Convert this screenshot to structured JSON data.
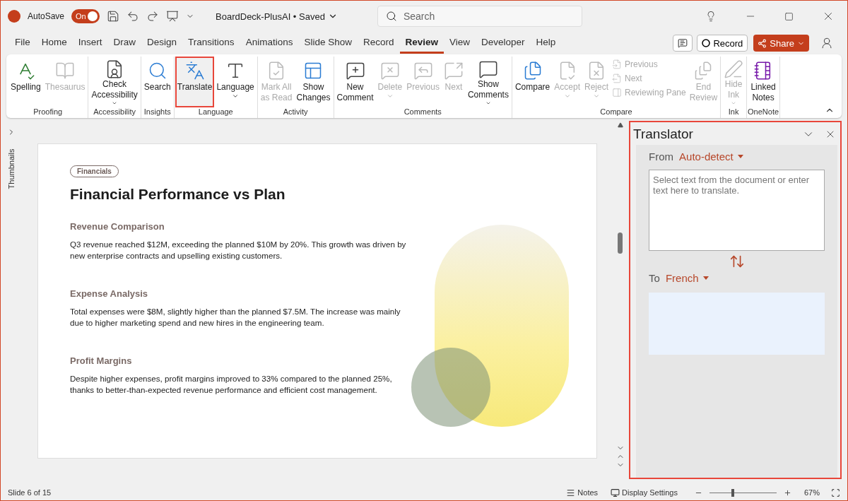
{
  "titlebar": {
    "autosave_label": "AutoSave",
    "autosave": {
      "label": "On",
      "on": true
    },
    "document": "BoardDeck-PlusAI • Saved",
    "search": {
      "placeholder": "Search"
    }
  },
  "tabs": [
    {
      "label": "File",
      "selected": false
    },
    {
      "label": "Home",
      "selected": false
    },
    {
      "label": "Insert",
      "selected": false
    },
    {
      "label": "Draw",
      "selected": false
    },
    {
      "label": "Design",
      "selected": false
    },
    {
      "label": "Transitions",
      "selected": false
    },
    {
      "label": "Animations",
      "selected": false
    },
    {
      "label": "Slide Show",
      "selected": false
    },
    {
      "label": "Record",
      "selected": false
    },
    {
      "label": "Review",
      "selected": true
    },
    {
      "label": "View",
      "selected": false
    },
    {
      "label": "Developer",
      "selected": false
    },
    {
      "label": "Help",
      "selected": false
    }
  ],
  "actions": {
    "record": "Record",
    "share": "Share"
  },
  "ribbon": [
    {
      "label": "Proofing",
      "items": [
        {
          "kind": "large",
          "label": "Spelling",
          "disabled": false
        },
        {
          "kind": "large",
          "label": "Thesaurus",
          "disabled": true
        }
      ]
    },
    {
      "label": "Accessibility",
      "items": [
        {
          "kind": "large",
          "label": "Check\nAccessibility",
          "disabled": false,
          "dropdown": true
        }
      ]
    },
    {
      "label": "Insights",
      "items": [
        {
          "kind": "large",
          "label": "Search",
          "disabled": false
        }
      ]
    },
    {
      "label": "Language",
      "items": [
        {
          "kind": "large",
          "label": "Translate",
          "disabled": false,
          "highlighted": true
        },
        {
          "kind": "large",
          "label": "Language",
          "disabled": false,
          "dropdown": true
        }
      ]
    },
    {
      "label": "Activity",
      "items": [
        {
          "kind": "large",
          "label": "Mark All\nas Read",
          "disabled": true
        },
        {
          "kind": "large",
          "label": "Show\nChanges",
          "disabled": false
        }
      ]
    },
    {
      "label": "Comments",
      "items": [
        {
          "kind": "large",
          "label": "New\nComment",
          "disabled": false
        },
        {
          "kind": "large",
          "label": "Delete",
          "disabled": true,
          "dropdown": true
        },
        {
          "kind": "large",
          "label": "Previous",
          "disabled": true
        },
        {
          "kind": "large",
          "label": "Next",
          "disabled": true
        },
        {
          "kind": "large",
          "label": "Show\nComments",
          "disabled": false,
          "dropdown": true
        }
      ]
    },
    {
      "label": "Compare",
      "items": [
        {
          "kind": "large",
          "label": "Compare",
          "disabled": false
        },
        {
          "kind": "large",
          "label": "Accept",
          "disabled": true,
          "dropdown": true
        },
        {
          "kind": "large",
          "label": "Reject",
          "disabled": true,
          "dropdown": true
        },
        {
          "kind": "small",
          "label": "Previous",
          "disabled": true
        },
        {
          "kind": "small",
          "label": "Next",
          "disabled": true
        },
        {
          "kind": "small",
          "label": "Reviewing Pane",
          "disabled": true
        },
        {
          "kind": "large",
          "label": "End\nReview",
          "disabled": true
        }
      ]
    },
    {
      "label": "Ink",
      "items": [
        {
          "kind": "large",
          "label": "Hide\nInk",
          "disabled": true,
          "dropdown": true
        }
      ]
    },
    {
      "label": "OneNote",
      "items": [
        {
          "kind": "large",
          "label": "Linked\nNotes",
          "disabled": false
        }
      ]
    }
  ],
  "thumbnails_label": "Thumbnails",
  "slide": {
    "tag": "Financials",
    "title": "Financial Performance vs Plan",
    "sections": [
      {
        "heading": "Revenue Comparison",
        "body": "Q3 revenue reached $12M, exceeding the planned $10M by 20%. This growth was driven by new enterprise contracts and upselling existing customers."
      },
      {
        "heading": "Expense Analysis",
        "body": "Total expenses were $8M, slightly higher than the planned $7.5M. The increase was mainly due to higher marketing spend and new hires in the engineering team."
      },
      {
        "heading": "Profit Margins",
        "body": "Despite higher expenses, profit margins improved to 33% compared to the planned 25%, thanks to better-than-expected revenue performance and efficient cost management."
      }
    ]
  },
  "translator": {
    "title": "Translator",
    "highlighted": true,
    "from_label": "From",
    "from": "Auto-detect",
    "input": {
      "placeholder": "Select text from the document or enter text here to translate."
    },
    "to_label": "To",
    "to": "French"
  },
  "status_bar": {
    "slide": "Slide 6 of 15",
    "notes": "Notes",
    "display": "Display Settings",
    "zoom": {
      "level": 0.33
    },
    "zoom_reading": "67%"
  }
}
